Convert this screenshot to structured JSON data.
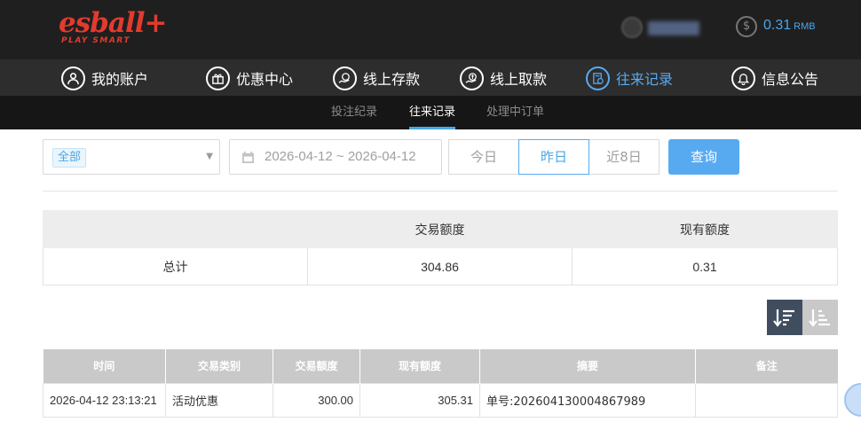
{
  "brand": {
    "logo_text": "esball+",
    "tagline": "PLAY SMART"
  },
  "user": {
    "balance": "0.31",
    "currency": "RMB",
    "balance_icon": "dollar-coin-icon"
  },
  "main_nav": [
    {
      "label": "我的账户",
      "icon": "user-icon"
    },
    {
      "label": "优惠中心",
      "icon": "gift-icon"
    },
    {
      "label": "线上存款",
      "icon": "deposit-icon"
    },
    {
      "label": "线上取款",
      "icon": "withdraw-icon"
    },
    {
      "label": "往来记录",
      "icon": "record-icon",
      "active": true
    },
    {
      "label": "信息公告",
      "icon": "bell-icon"
    }
  ],
  "sub_nav": [
    {
      "label": "投注纪录"
    },
    {
      "label": "往来记录",
      "active": true
    },
    {
      "label": "处理中订单"
    }
  ],
  "filters": {
    "type_value": "全部",
    "date_range": "2026-04-12 ~ 2026-04-12",
    "quick_ranges": [
      "今日",
      "昨日",
      "近8日"
    ],
    "active_range": "昨日",
    "query_label": "查询"
  },
  "summary": {
    "headers": [
      "",
      "交易额度",
      "现有额度"
    ],
    "row": {
      "label": "总计",
      "amount": "304.86",
      "balance": "0.31"
    }
  },
  "detail": {
    "headers": [
      "时间",
      "交易类别",
      "交易额度",
      "现有额度",
      "摘要",
      "备注"
    ],
    "rows": [
      {
        "time": "2026-04-12 23:13:21",
        "type": "活动优惠",
        "amount": "300.00",
        "balance": "305.31",
        "summary": "单号:202604130004867989",
        "note": ""
      }
    ]
  },
  "colors": {
    "accent": "#58aaf0",
    "header_bg": "#1f1f1f",
    "nav_bg": "#2d2d2d",
    "subnav_bg": "#161616",
    "logo": "#e23b2e"
  }
}
